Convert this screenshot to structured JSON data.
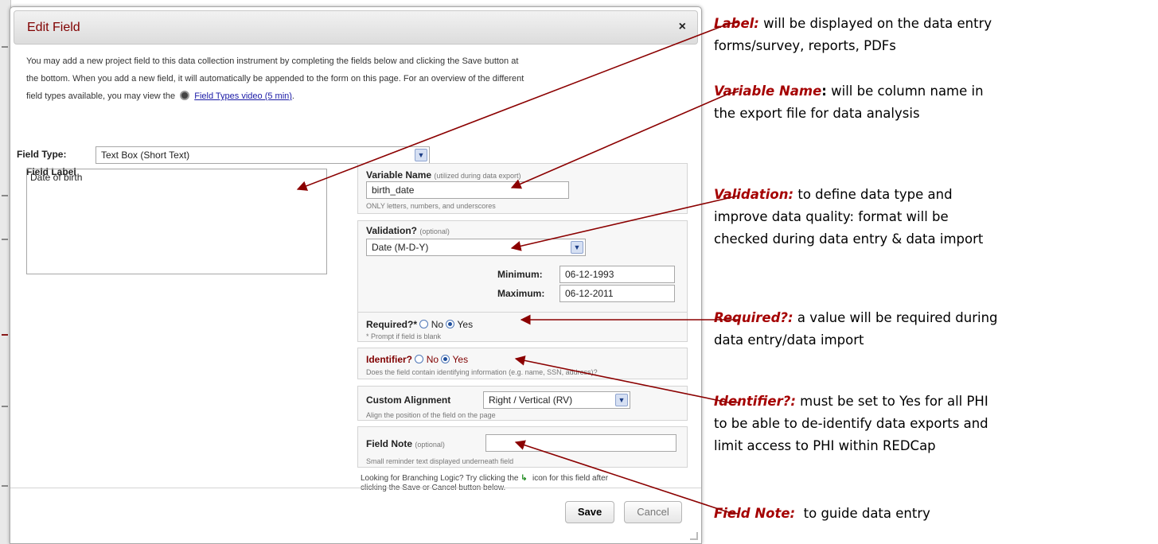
{
  "dialog": {
    "title": "Edit Field",
    "close_glyph": "×",
    "intro_line1": "You may add a new project field to this data collection instrument by completing the fields below and clicking the Save button at",
    "intro_line2": "the bottom. When you add a new field, it will automatically be appended to the form on this page. For an overview of the different",
    "intro_line3": "field types available, you may view the",
    "intro_link": "Field Types video (5 min)",
    "intro_end": ".",
    "field_type": {
      "label": "Field Type:",
      "value": "Text Box (Short Text)"
    },
    "field_label": {
      "label": "Field Label",
      "value": "Date of birth"
    },
    "variable_name": {
      "label": "Variable Name",
      "hint": "(utilized during data export)",
      "value": "birth_date",
      "note": "ONLY letters, numbers, and underscores"
    },
    "validation": {
      "label": "Validation?",
      "hint": "(optional)",
      "value": "Date (M-D-Y)",
      "min_label": "Minimum:",
      "min_value": "06-12-1993",
      "max_label": "Maximum:",
      "max_value": "06-12-2011"
    },
    "required": {
      "label": "Required?*",
      "no": "No",
      "yes": "Yes",
      "note": "* Prompt if field is blank"
    },
    "identifier": {
      "label": "Identifier?",
      "no": "No",
      "yes": "Yes",
      "note": "Does the field contain identifying information (e.g. name, SSN, address)?"
    },
    "alignment": {
      "label": "Custom Alignment",
      "value": "Right / Vertical (RV)",
      "note": "Align the position of the field on the page"
    },
    "field_note": {
      "label": "Field Note",
      "hint": "(optional)",
      "value": "",
      "note": "Small reminder text displayed underneath field"
    },
    "branching_line1": "Looking for Branching Logic? Try clicking the",
    "branching_line2": "icon for this field after",
    "branching_line3": "clicking the Save or Cancel button below.",
    "save_label": "Save",
    "cancel_label": "Cancel"
  },
  "annotations": [
    {
      "key": "Label:",
      "line1": " will be displayed on the data entry",
      "line2": "forms/survey, reports, PDFs"
    },
    {
      "key": "Variable Name",
      "colon": ":",
      "line1": " will be column name in",
      "line2": "the export file for data analysis"
    },
    {
      "key": "Validation:",
      "line1": " to define data type and",
      "line2": "improve data quality: format will be",
      "line3": "checked during data entry & data import"
    },
    {
      "key": "Required?:",
      "line1": " a value will be required during",
      "line2": "data entry/data import"
    },
    {
      "key": "Identifier?:",
      "line1": " must be set to Yes for all PHI",
      "line2": "to be able to de-identify data exports and",
      "line3": "limit access to PHI within REDCap"
    },
    {
      "key": "Field Note:",
      "line1": "  to guide data entry"
    }
  ],
  "colors": {
    "accent": "#a50000",
    "title": "#800000",
    "link": "#1a1aa6",
    "select_arrow": "#d6e0f3"
  }
}
